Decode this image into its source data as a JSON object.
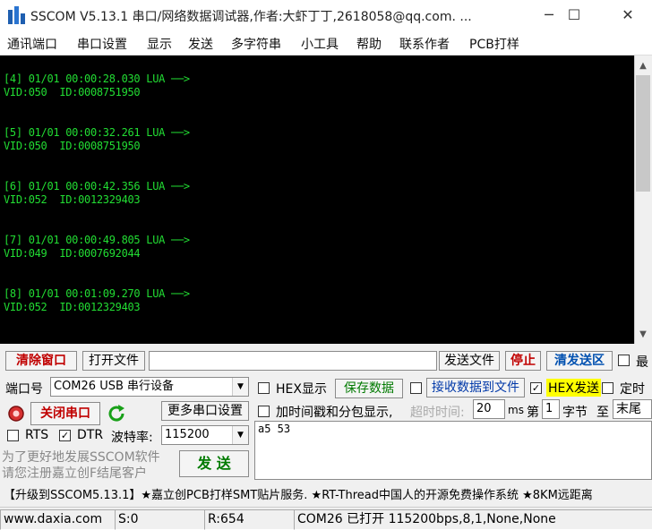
{
  "window": {
    "title": "SSCOM V5.13.1 串口/网络数据调试器,作者:大虾丁丁,2618058@qq.com. ...",
    "minimize": "─",
    "maximize": "☐",
    "close": "✕"
  },
  "menu": [
    "通讯端口",
    "串口设置",
    "显示",
    "发送",
    "多字符串",
    "小工具",
    "帮助",
    "联系作者",
    "PCB打样"
  ],
  "terminal": {
    "lines": [
      "[4] 01/01 00:00:28.030 LUA ──>",
      "VID:050  ID:0008751950",
      "[5] 01/01 00:00:32.261 LUA ──>",
      "VID:050  ID:0008751950",
      "[6] 01/01 00:00:42.356 LUA ──>",
      "VID:052  ID:0012329403",
      "[7] 01/01 00:00:49.805 LUA ──>",
      "VID:049  ID:0007692044",
      "[8] 01/01 00:01:09.270 LUA ──>",
      "VID:052  ID:0012329403"
    ],
    "text_color": "#22dd33",
    "background": "#000000"
  },
  "toolbar": {
    "clear_window": "清除窗口",
    "open_file": "打开文件",
    "file_path": "",
    "send_file": "发送文件",
    "stop": "停止",
    "clear_send": "清发送区",
    "last_label": "最"
  },
  "port": {
    "port_label": "端口号",
    "port_value": "COM26 USB 串行设备",
    "close_port": "关闭串口",
    "more_settings": "更多串口设置",
    "rts_label": "RTS",
    "rts_checked": false,
    "dtr_label": "DTR",
    "dtr_checked": true,
    "baud_label": "波特率:",
    "baud_value": "115200",
    "promo_line1": "为了更好地发展SSCOM软件",
    "promo_line2": "请您注册嘉立创F结尾客户"
  },
  "options": {
    "hex_display": "HEX显示",
    "hex_display_checked": false,
    "save_data": "保存数据",
    "recv_to_file": "接收数据到文件",
    "recv_to_file_checked": false,
    "hex_send": "HEX发送",
    "hex_send_checked": true,
    "timed_send": "定时",
    "timed_send_checked": false,
    "timestamp": "加时间戳和分包显示,",
    "timestamp_checked": false,
    "timeout_label": "超时时间:",
    "timeout_value": "20",
    "ms_label": "ms",
    "nth_label": "第",
    "byte_index": "1",
    "byte_label": "字节",
    "to_label": "至",
    "end_value": "末尾"
  },
  "send": {
    "send_text": "a5 53",
    "send_button": "发 送"
  },
  "ticker": "【升级到SSCOM5.13.1】★嘉立创PCB打样SMT贴片服务. ★RT-Thread中国人的开源免费操作系统 ★8KM远距离",
  "status": {
    "website": "www.daxia.com",
    "sent": "S:0",
    "received": "R:654",
    "port_state": "COM26 已打开  115200bps,8,1,None,None"
  }
}
